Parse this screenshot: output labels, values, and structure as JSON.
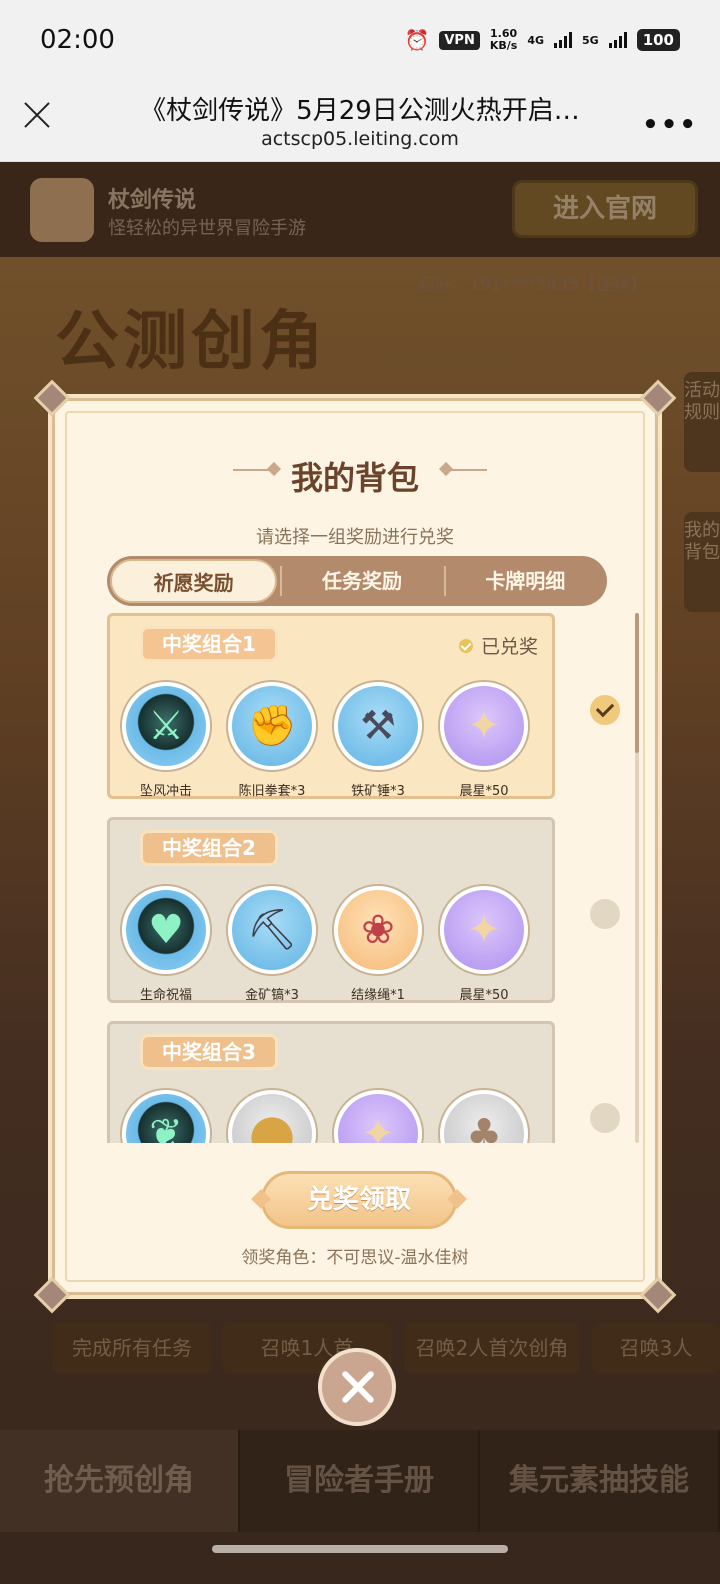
{
  "status_bar": {
    "time": "02:00",
    "vpn": "VPN",
    "speed_value": "1.60",
    "speed_unit": "KB/s",
    "net1": "4G",
    "net2": "5G",
    "battery": "100"
  },
  "browser": {
    "title": "《杖剑传说》5月29日公测火热开启…",
    "url": "actscp05.leiting.com"
  },
  "background_page": {
    "app_name": "杖剑传说",
    "slogan": "怪轻松的异世界冒险手游",
    "enter_button": "进入官网",
    "user_info": "您好，191****3635【注销】",
    "hero_text": "公测创角",
    "side_rules": "活动规则",
    "side_bag": "我的背包",
    "task_all": "完成所有任务",
    "task_1": "召唤1人首",
    "task_2": "召唤2人首次创角",
    "task_3": "召唤3人",
    "nav": [
      "抢先预创角",
      "冒险者手册",
      "集元素抽技能"
    ]
  },
  "modal": {
    "title": "我的背包",
    "subtitle": "请选择一组奖励进行兑奖",
    "tabs": [
      "祈愿奖励",
      "任务奖励",
      "卡牌明细"
    ],
    "active_tab": 0,
    "groups": [
      {
        "label": "中奖组合1",
        "redeemed_text": "已兑奖",
        "selected": true,
        "items": [
          {
            "name": "坠风冲击",
            "icon": "sword-skill-icon",
            "color": "dblue",
            "glyph": "⚔"
          },
          {
            "name": "陈旧拳套*3",
            "icon": "boxing-glove-icon",
            "color": "blue",
            "glyph": "🥊"
          },
          {
            "name": "铁矿锤*3",
            "icon": "hammer-icon",
            "color": "blue",
            "glyph": "🔨"
          },
          {
            "name": "晨星*50",
            "icon": "star-crystal-icon",
            "color": "purple",
            "glyph": "✦"
          }
        ]
      },
      {
        "label": "中奖组合2",
        "selected": false,
        "items": [
          {
            "name": "生命祝福",
            "icon": "heart-skill-icon",
            "color": "dblue",
            "glyph": "♥"
          },
          {
            "name": "金矿镐*3",
            "icon": "pickaxe-icon",
            "color": "blue",
            "glyph": "⛏"
          },
          {
            "name": "结缘绳*1",
            "icon": "paw-charm-icon",
            "color": "orange",
            "glyph": "🐾"
          },
          {
            "name": "晨星*50",
            "icon": "star-crystal-icon",
            "color": "purple",
            "glyph": "✦"
          }
        ]
      },
      {
        "label": "中奖组合3",
        "selected": false,
        "items": [
          {
            "name": "",
            "icon": "thorn-skill-icon",
            "color": "dblue",
            "glyph": "❦"
          },
          {
            "name": "",
            "icon": "gold-coin-icon",
            "color": "gray",
            "glyph": "●"
          },
          {
            "name": "",
            "icon": "star-crystal-icon",
            "color": "purple",
            "glyph": "✦"
          },
          {
            "name": "",
            "icon": "seed-bag-icon",
            "color": "gray",
            "glyph": "👝"
          }
        ]
      }
    ],
    "claim_button": "兑奖领取",
    "role_text": "领奖角色：不可思议-温水佳树"
  },
  "colors": {
    "accent": "#f4c592",
    "modal_bg": "#fdf4e3",
    "tab_bar": "#b48a6d"
  }
}
